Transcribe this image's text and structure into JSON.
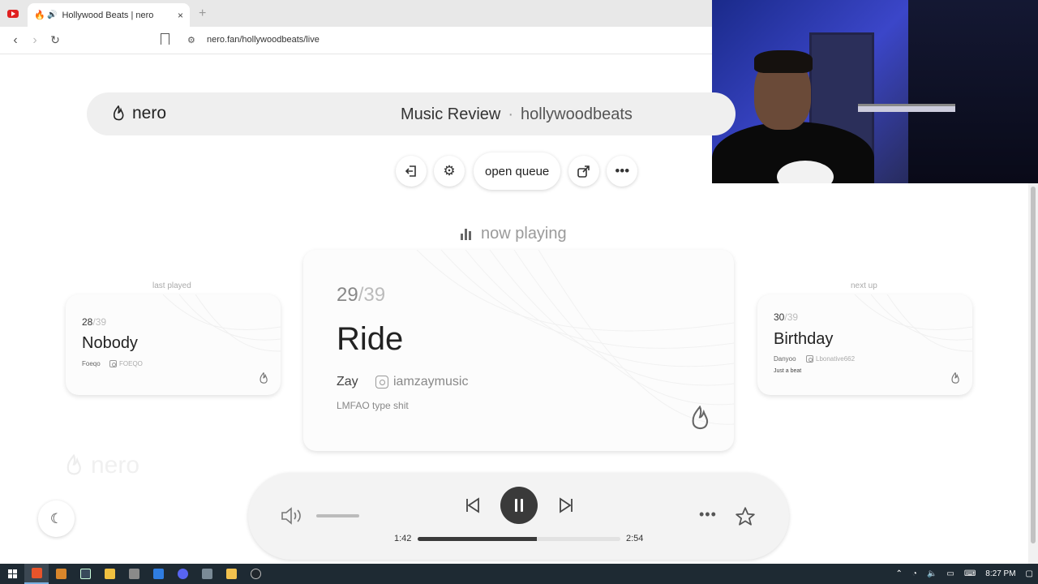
{
  "browser": {
    "tab_title": "Hollywood Beats | nero",
    "tab_close": "×",
    "new_tab": "+",
    "url": "nero.fan/hollywoodbeats/live"
  },
  "header": {
    "logo": "nero",
    "title": "Music Review",
    "separator": "·",
    "subtitle": "hollywoodbeats"
  },
  "actions": {
    "open_queue": "open queue"
  },
  "now_playing_label": "now playing",
  "current": {
    "position": "29",
    "total": "/39",
    "title": "Ride",
    "artist": "Zay",
    "handle": "iamzaymusic",
    "note": "LMFAO type shit"
  },
  "last_played": {
    "label": "last played",
    "position": "28",
    "total": "/39",
    "title": "Nobody",
    "artist": "Foeqo",
    "handle": "FOEQO"
  },
  "next_up": {
    "label": "next up",
    "position": "30",
    "total": "/39",
    "title": "Birthday",
    "artist": "Danyoo",
    "handle": "Lbonative662",
    "note": "Just a beat"
  },
  "watermark": "nero",
  "player": {
    "time_current": "1:42",
    "time_total": "2:54",
    "progress_fraction": 0.586,
    "volume_fraction": 1.0
  },
  "taskbar": {
    "time": "8:27 PM"
  },
  "icons": {
    "back": "back-arrow-icon",
    "forward": "forward-arrow-icon",
    "reload": "reload-icon",
    "exit": "exit-icon",
    "settings": "gear-icon",
    "share": "share-icon",
    "more": "more-icon",
    "moon": "moon-icon",
    "volume": "volume-icon",
    "prev": "skip-back-icon",
    "pause": "pause-icon",
    "next": "skip-forward-icon",
    "star": "star-icon"
  }
}
